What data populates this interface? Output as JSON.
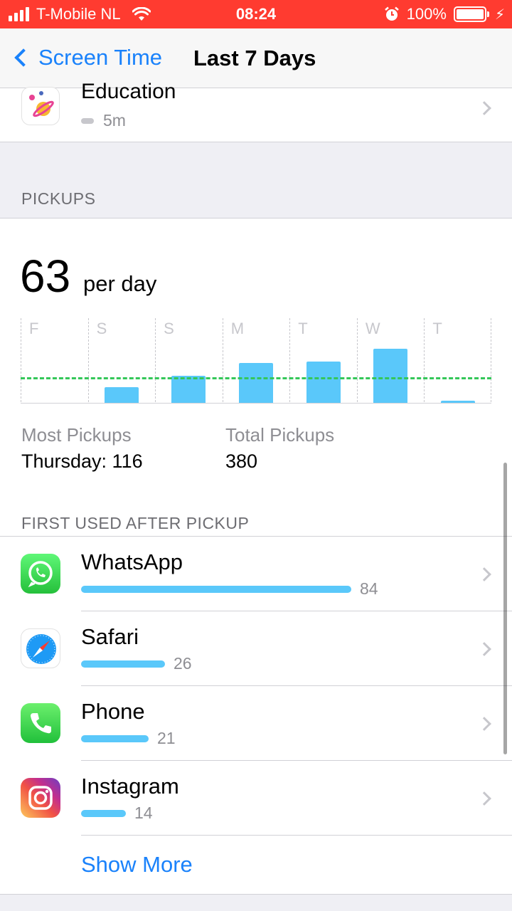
{
  "status_bar": {
    "carrier": "T-Mobile NL",
    "time": "08:24",
    "battery": "100%",
    "signal_bars": 4
  },
  "nav": {
    "back_label": "Screen Time",
    "title": "Last 7 Days"
  },
  "education": {
    "title": "Education",
    "time": "5m"
  },
  "pickups": {
    "header": "PICKUPS",
    "count": "63",
    "unit": "per day",
    "most_label": "Most Pickups",
    "most_value": "Thursday: 116",
    "total_label": "Total Pickups",
    "total_value": "380"
  },
  "chart_data": {
    "type": "bar",
    "categories": [
      "F",
      "S",
      "S",
      "M",
      "T",
      "W",
      "T"
    ],
    "values": [
      0,
      24,
      42,
      62,
      65,
      85,
      3
    ],
    "average": 40,
    "ylim": [
      0,
      116
    ],
    "grid": true,
    "colors": {
      "bar": "#5ac8fa",
      "average_line": "#34c759"
    }
  },
  "first_used": {
    "header": "FIRST USED AFTER PICKUP",
    "apps": [
      {
        "name": "WhatsApp",
        "count": "84",
        "value": 84,
        "icon": "whatsapp-icon"
      },
      {
        "name": "Safari",
        "count": "26",
        "value": 26,
        "icon": "safari-icon"
      },
      {
        "name": "Phone",
        "count": "21",
        "value": 21,
        "icon": "phone-icon"
      },
      {
        "name": "Instagram",
        "count": "14",
        "value": 14,
        "icon": "instagram-icon"
      }
    ],
    "show_more": "Show More"
  },
  "colors": {
    "status_bar": "#ff3b30",
    "accent": "#1a82fb",
    "bar": "#5ac8fa",
    "average_line": "#34c759"
  }
}
